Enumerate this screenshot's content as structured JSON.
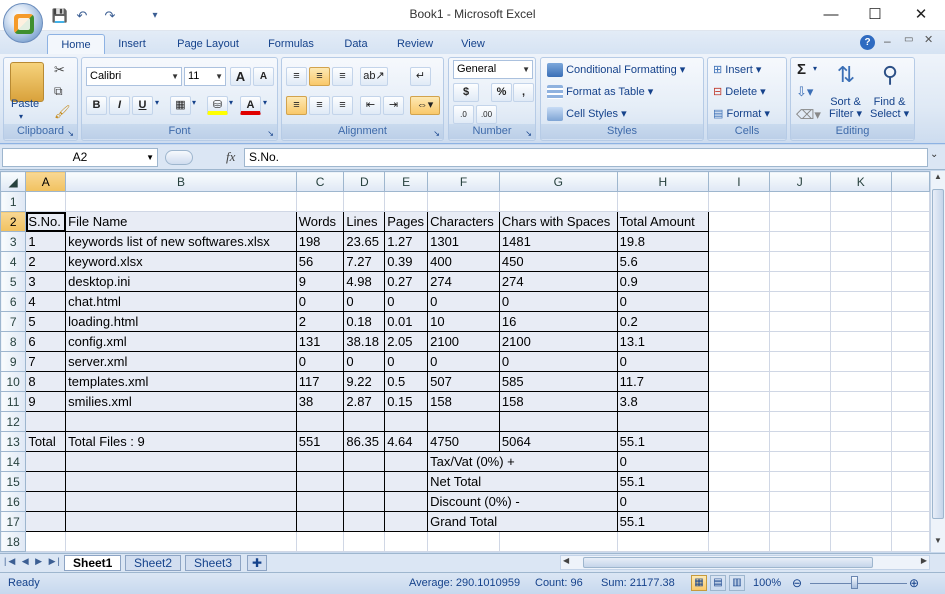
{
  "window": {
    "title": "Book1 - Microsoft Excel",
    "minimize": "—",
    "maximize": "☐",
    "close": "✕"
  },
  "tabs": [
    "Home",
    "Insert",
    "Page Layout",
    "Formulas",
    "Data",
    "Review",
    "View"
  ],
  "ribbon": {
    "clipboard": {
      "label": "Clipboard",
      "paste": "Paste"
    },
    "font": {
      "label": "Font",
      "name": "Calibri",
      "size": "11",
      "bold": "B",
      "italic": "I",
      "underline": "U",
      "grow": "A",
      "shrink": "A"
    },
    "alignment": {
      "label": "Alignment"
    },
    "number": {
      "label": "Number",
      "format": "General",
      "currency": "$",
      "percent": "%",
      "comma": ",",
      "inc_decimal": ".00 →.0",
      "dec_decimal": ".00 ←.0",
      "inc": ".0",
      "dec": ".00"
    },
    "styles": {
      "label": "Styles",
      "conditional": "Conditional Formatting",
      "table": "Format as Table",
      "cell": "Cell Styles"
    },
    "cells": {
      "label": "Cells",
      "insert": "Insert",
      "delete": "Delete",
      "format": "Format"
    },
    "editing": {
      "label": "Editing",
      "sort1": "Sort &",
      "sort2": "Filter",
      "find1": "Find &",
      "find2": "Select",
      "sum": "Σ"
    }
  },
  "formula_bar": {
    "name_box": "A2",
    "fx": "fx",
    "content": "S.No."
  },
  "columns": [
    "A",
    "B",
    "C",
    "D",
    "E",
    "F",
    "G",
    "H",
    "I",
    "J",
    "K"
  ],
  "rows": [
    [
      "",
      "",
      "",
      "",
      "",
      "",
      "",
      ""
    ],
    [
      "S.No.",
      "File Name",
      "Words",
      "Lines",
      "Pages",
      "Characters",
      "Chars with Spaces",
      "Total Amount"
    ],
    [
      "1",
      "keywords list of new softwares.xlsx",
      "198",
      "23.65",
      "1.27",
      "1301",
      "1481",
      "19.8"
    ],
    [
      "2",
      "keyword.xlsx",
      "56",
      "7.27",
      "0.39",
      "400",
      "450",
      "5.6"
    ],
    [
      "3",
      "desktop.ini",
      "9",
      "4.98",
      "0.27",
      "274",
      "274",
      "0.9"
    ],
    [
      "4",
      "chat.html",
      "0",
      "0",
      "0",
      "0",
      "0",
      "0"
    ],
    [
      "5",
      "loading.html",
      "2",
      "0.18",
      "0.01",
      "10",
      "16",
      "0.2"
    ],
    [
      "6",
      "config.xml",
      "131",
      "38.18",
      "2.05",
      "2100",
      "2100",
      "13.1"
    ],
    [
      "7",
      "server.xml",
      "0",
      "0",
      "0",
      "0",
      "0",
      "0"
    ],
    [
      "8",
      "templates.xml",
      "117",
      "9.22",
      "0.5",
      "507",
      "585",
      "11.7"
    ],
    [
      "9",
      "smilies.xml",
      "38",
      "2.87",
      "0.15",
      "158",
      "158",
      "3.8"
    ],
    [
      "",
      "",
      "",
      "",
      "",
      "",
      "",
      ""
    ],
    [
      "Total",
      "Total Files : 9",
      "551",
      "86.35",
      "4.64",
      "4750",
      "5064",
      "55.1"
    ],
    [
      "",
      "",
      "",
      "",
      "",
      "Tax/Vat (0%) +",
      "",
      "0"
    ],
    [
      "",
      "",
      "",
      "",
      "",
      "Net Total",
      "",
      "55.1"
    ],
    [
      "",
      "",
      "",
      "",
      "",
      "Discount (0%) -",
      "",
      "0"
    ],
    [
      "",
      "",
      "",
      "",
      "",
      "Grand Total",
      "",
      "55.1"
    ],
    [
      "",
      "",
      "",
      "",
      "",
      "",
      "",
      ""
    ]
  ],
  "sheets": [
    "Sheet1",
    "Sheet2",
    "Sheet3"
  ],
  "status": {
    "ready": "Ready",
    "average": "Average: 290.1010959",
    "count": "Count: 96",
    "sum": "Sum: 21177.38",
    "zoom": "100%"
  },
  "accent_color": "#15428b",
  "selection_color": "#f1c15f"
}
